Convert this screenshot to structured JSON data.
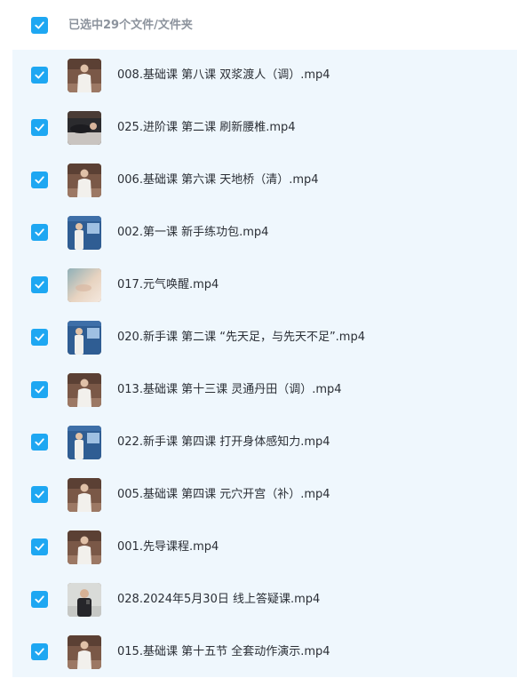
{
  "header": {
    "select_all_checked": true,
    "selected_text": "已选中29个文件/文件夹"
  },
  "colors": {
    "checkbox": "#1ea7f2",
    "panel_bg": "#eff7fd",
    "text": "#2b2f36",
    "muted_text": "#8c939d"
  },
  "files": [
    {
      "name": "008.基础课 第八课 双浆渡人（调）.mp4",
      "checked": true,
      "thumb": "person-video-thumbnail"
    },
    {
      "name": "025.进阶课 第二课 刷新腰椎.mp4",
      "checked": true,
      "thumb": "lying-person-video-thumbnail"
    },
    {
      "name": "006.基础课 第六课 天地桥（清）.mp4",
      "checked": true,
      "thumb": "person-video-thumbnail"
    },
    {
      "name": "002.第一课 新手练功包.mp4",
      "checked": true,
      "thumb": "presentation-video-thumbnail"
    },
    {
      "name": "017.元气唤醒.mp4",
      "checked": true,
      "thumb": "sand-video-thumbnail"
    },
    {
      "name": "020.新手课 第二课 “先天足，与先天不足”.mp4",
      "checked": true,
      "thumb": "presentation-video-thumbnail"
    },
    {
      "name": "013.基础课 第十三课 灵通丹田（调）.mp4",
      "checked": true,
      "thumb": "person-video-thumbnail"
    },
    {
      "name": "022.新手课 第四课 打开身体感知力.mp4",
      "checked": true,
      "thumb": "presentation-video-thumbnail"
    },
    {
      "name": "005.基础课 第四课 元穴开宫（补）.mp4",
      "checked": true,
      "thumb": "person-video-thumbnail"
    },
    {
      "name": "001.先导课程.mp4",
      "checked": true,
      "thumb": "person-video-thumbnail"
    },
    {
      "name": "028.2024年5月30日 线上答疑课.mp4",
      "checked": true,
      "thumb": "speaker-video-thumbnail"
    },
    {
      "name": "015.基础课 第十五节 全套动作演示.mp4",
      "checked": true,
      "thumb": "person-video-thumbnail"
    }
  ]
}
